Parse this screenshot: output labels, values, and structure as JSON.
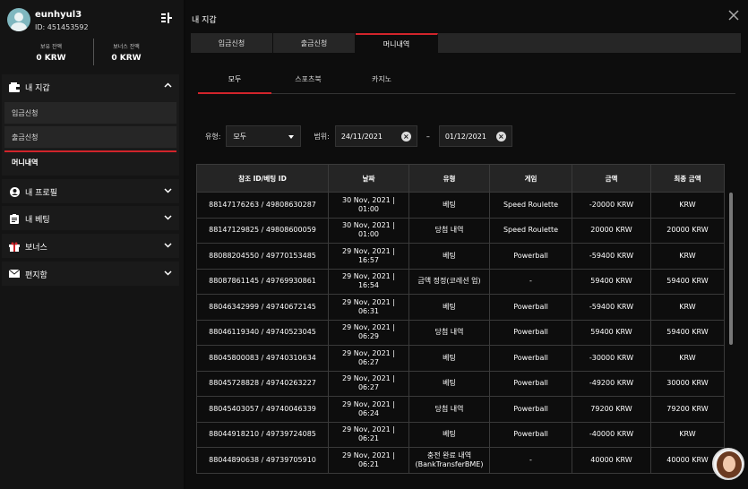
{
  "profile": {
    "username": "eunhyul3",
    "user_id": "ID: 451453592",
    "balances": [
      {
        "label": "보유 잔액",
        "value": "0 KRW"
      },
      {
        "label": "보너스 잔액",
        "value": "0 KRW"
      }
    ]
  },
  "sidebar": {
    "wallet": {
      "label": "내 지갑",
      "items": [
        "입금신청",
        "출금신청",
        "머니내역"
      ]
    },
    "sections": [
      {
        "label": "내 프로필",
        "icon": "user-icon"
      },
      {
        "label": "내 베팅",
        "icon": "clipboard-icon"
      },
      {
        "label": "보너스",
        "icon": "gift-icon"
      },
      {
        "label": "편지함",
        "icon": "envelope-icon"
      }
    ]
  },
  "main": {
    "title": "내 지갑",
    "tabs": [
      "입금신청",
      "출금신청",
      "머니내역"
    ],
    "subtabs": [
      "모두",
      "스포츠북",
      "카지노"
    ],
    "filters": {
      "type_label": "유형:",
      "type_value": "모두",
      "range_label": "범위:",
      "date_from": "24/11/2021",
      "date_to": "01/12/2021",
      "separator": "–"
    },
    "table": {
      "headers": [
        "참조 ID/베팅 ID",
        "날짜",
        "유형",
        "게임",
        "금액",
        "최종 금액"
      ],
      "rows": [
        {
          "id": "88147176263 / 49808630287",
          "date1": "30 Nov, 2021 |",
          "date2": "01:00",
          "type1": "베팅",
          "type2": "",
          "game": "Speed Roulette",
          "amount": "-20000 KRW",
          "final": "KRW"
        },
        {
          "id": "88147129825 / 49808600059",
          "date1": "30 Nov, 2021 |",
          "date2": "01:00",
          "type1": "당첨 내역",
          "type2": "",
          "game": "Speed Roulette",
          "amount": "20000 KRW",
          "final": "20000 KRW"
        },
        {
          "id": "88088204550 / 49770153485",
          "date1": "29 Nov, 2021 |",
          "date2": "16:57",
          "type1": "베팅",
          "type2": "",
          "game": "Powerball",
          "amount": "-59400 KRW",
          "final": "KRW"
        },
        {
          "id": "88087861145 / 49769930861",
          "date1": "29 Nov, 2021 |",
          "date2": "16:54",
          "type1": "금액 정정(코레션 업)",
          "type2": "",
          "game": "-",
          "amount": "59400 KRW",
          "final": "59400 KRW"
        },
        {
          "id": "88046342999 / 49740672145",
          "date1": "29 Nov, 2021 |",
          "date2": "06:31",
          "type1": "베팅",
          "type2": "",
          "game": "Powerball",
          "amount": "-59400 KRW",
          "final": "KRW"
        },
        {
          "id": "88046119340 / 49740523045",
          "date1": "29 Nov, 2021 |",
          "date2": "06:29",
          "type1": "당첨 내역",
          "type2": "",
          "game": "Powerball",
          "amount": "59400 KRW",
          "final": "59400 KRW"
        },
        {
          "id": "88045800083 / 49740310634",
          "date1": "29 Nov, 2021 |",
          "date2": "06:27",
          "type1": "베팅",
          "type2": "",
          "game": "Powerball",
          "amount": "-30000 KRW",
          "final": "KRW"
        },
        {
          "id": "88045728828 / 49740263227",
          "date1": "29 Nov, 2021 |",
          "date2": "06:27",
          "type1": "베팅",
          "type2": "",
          "game": "Powerball",
          "amount": "-49200 KRW",
          "final": "30000 KRW"
        },
        {
          "id": "88045403057 / 49740046339",
          "date1": "29 Nov, 2021 |",
          "date2": "06:24",
          "type1": "당첨 내역",
          "type2": "",
          "game": "Powerball",
          "amount": "79200 KRW",
          "final": "79200 KRW"
        },
        {
          "id": "88044918210 / 49739724085",
          "date1": "29 Nov, 2021 |",
          "date2": "06:21",
          "type1": "베팅",
          "type2": "",
          "game": "Powerball",
          "amount": "-40000 KRW",
          "final": "KRW"
        },
        {
          "id": "88044890638 / 49739705910",
          "date1": "29 Nov, 2021 |",
          "date2": "06:21",
          "type1": "충전 완료 내역",
          "type2": "(BankTransferBME)",
          "game": "-",
          "amount": "40000 KRW",
          "final": "40000 KRW"
        }
      ]
    }
  },
  "colors": {
    "accent": "#d1242b",
    "background": "#0d0d0d",
    "panel": "#1a1a1a"
  }
}
